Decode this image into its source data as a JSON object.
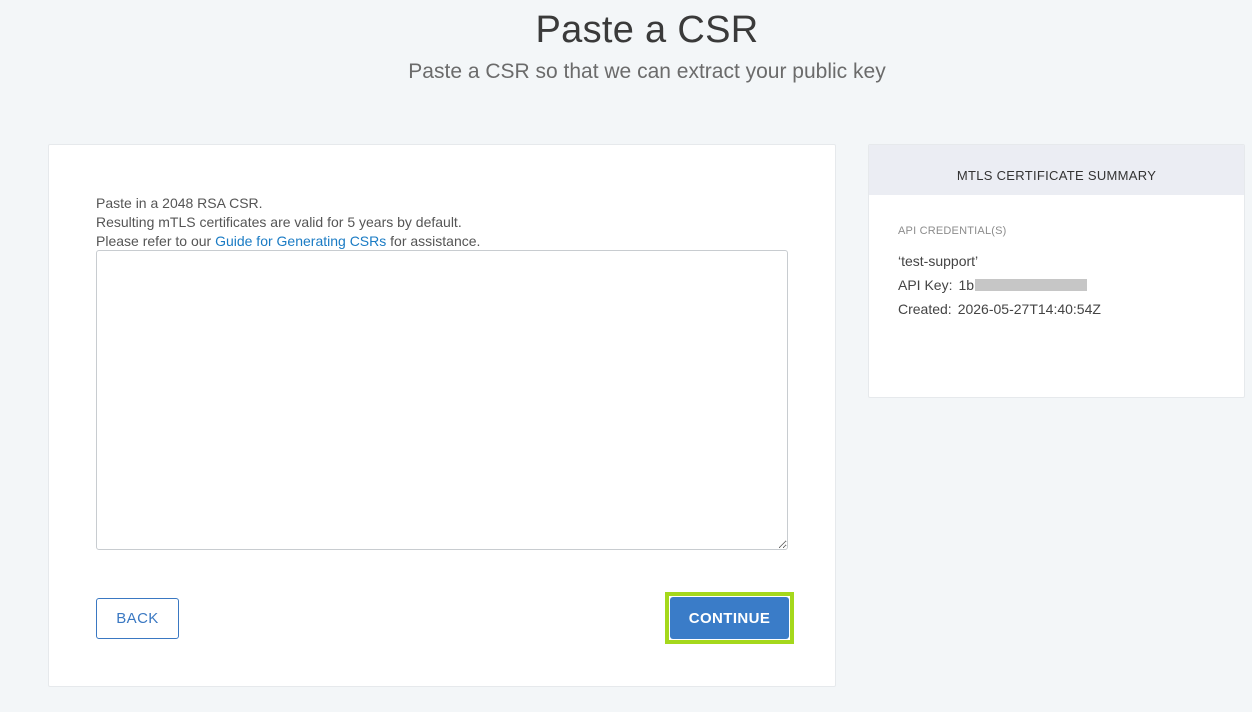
{
  "header": {
    "title": "Paste a CSR",
    "subtitle": "Paste a CSR so that we can extract your public key"
  },
  "form": {
    "line1": "Paste in a 2048 RSA CSR.",
    "line2": "Resulting mTLS certificates are valid for 5 years by default.",
    "line3_prefix": "Please refer to our ",
    "guide_link": "Guide for Generating CSRs",
    "line3_suffix": " for assistance.",
    "csr_value": "",
    "back_label": "BACK",
    "continue_label": "CONTINUE"
  },
  "summary": {
    "title": "MTLS CERTIFICATE SUMMARY",
    "section_label": "API CREDENTIAL(S)",
    "credential_name": "‘test-support’",
    "api_key_label": "API Key:",
    "api_key_visible": "1b",
    "created_label": "Created:",
    "created_value": "2026-05-27T14:40:54Z"
  },
  "colors": {
    "accent": "#3a7cc8",
    "highlight": "#a5d81c",
    "link": "#1a7bc4"
  }
}
